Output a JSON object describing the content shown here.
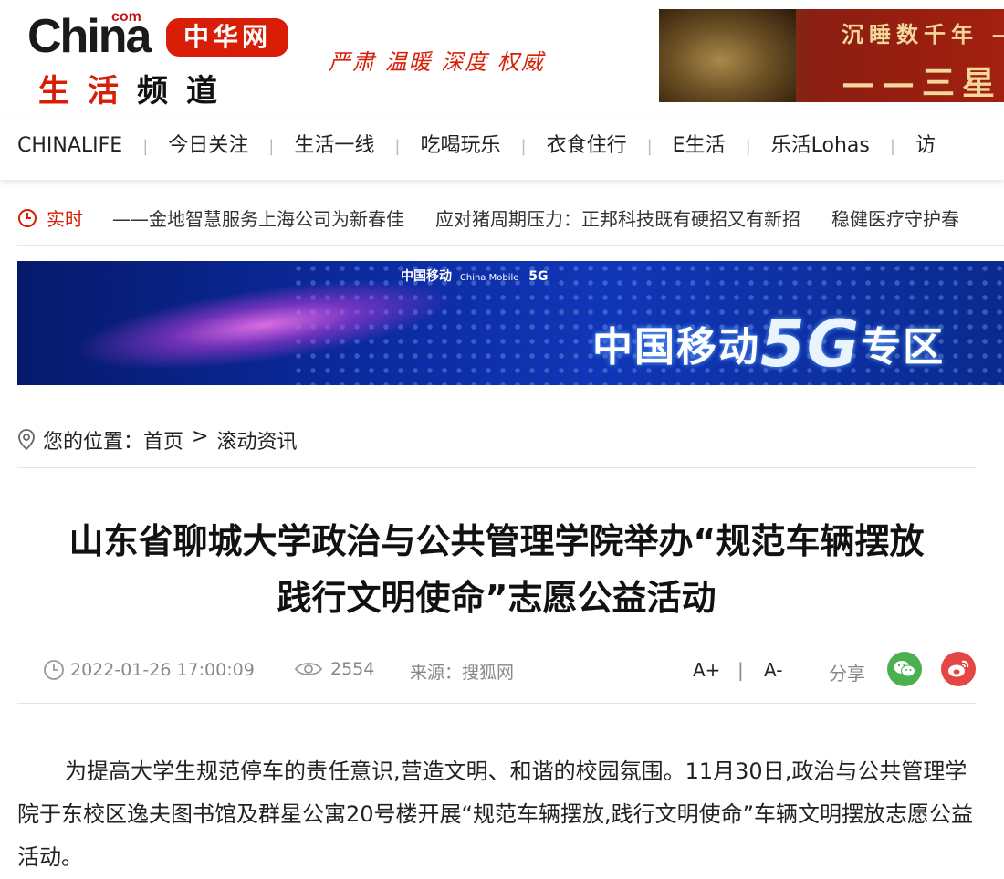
{
  "header": {
    "logo": {
      "com": "com",
      "china": "China",
      "badge": "中华网",
      "sub_red": "生活",
      "sub_black": "频道"
    },
    "slogan": "严肃 温暖 深度 权威",
    "ad": {
      "line1": "沉睡数千年 —",
      "line2": "——三星"
    }
  },
  "nav": {
    "items": [
      "CHINALIFE",
      "今日关注",
      "生活一线",
      "吃喝玩乐",
      "衣食住行",
      "E生活",
      "乐活Lohas",
      "访"
    ],
    "separator": "|"
  },
  "ticker": {
    "label": "实时",
    "items": [
      "——金地智慧服务上海公司为新春佳",
      "应对猪周期压力：正邦科技既有硬招又有新招",
      "稳健医疗守护春"
    ]
  },
  "banner": {
    "brand_cn": "中国移动",
    "brand_en": "China Mobile",
    "brand_5g": "5G",
    "title_pre": "中国移动",
    "title_big": "5G",
    "title_post": "专区"
  },
  "breadcrumb": {
    "label": "您的位置：",
    "home": "首页",
    "separator": ">",
    "current": "滚动资讯"
  },
  "article": {
    "title_line1": "山东省聊城大学政治与公共管理学院举办“规范车辆摆放",
    "title_line2": "践行文明使命”志愿公益活动",
    "datetime": "2022-01-26 17:00:09",
    "views": "2554",
    "source": "来源：搜狐网",
    "font_increase": "A+",
    "font_divider": "|",
    "font_decrease": "A-",
    "share_label": "分享",
    "body": "为提高大学生规范停车的责任意识,营造文明、和谐的校园氛围。11月30日,政治与公共管理学院于东校区逸夫图书馆及群星公寓20号楼开展“规范车辆摆放,践行文明使命”车辆文明摆放志愿公益活动。"
  },
  "colors": {
    "brand_red": "#d81e06",
    "wechat_green": "#4caf50",
    "weibo_red": "#e64545"
  }
}
